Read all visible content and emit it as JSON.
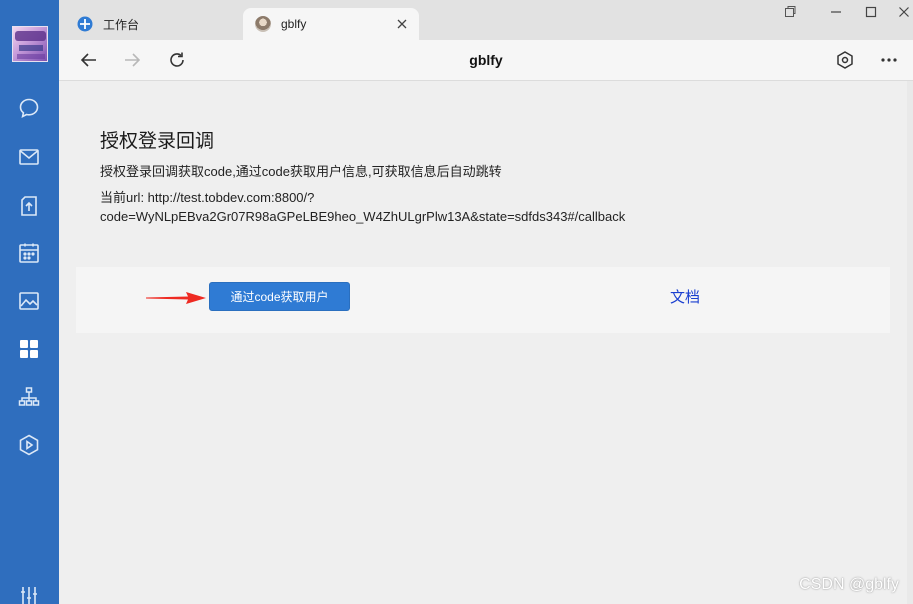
{
  "tabs": [
    {
      "label": "工作台"
    },
    {
      "label": "gblfy"
    }
  ],
  "toolbar": {
    "title": "gblfy"
  },
  "content": {
    "heading": "授权登录回调",
    "description": "授权登录回调获取code,通过code获取用户信息,可获取信息后自动跳转",
    "url_line1": "当前url: http://test.tobdev.com:8800/?",
    "url_line2": "code=WyNLpEBva2Gr07R98aGPeLBE9heo_W4ZhULgrPlw13A&state=sdfds343#/callback",
    "action_button": "通过code获取用户",
    "doc_link": "文档"
  },
  "watermark": "CSDN @gblfy",
  "colors": {
    "sidebar": "#2f6ebe",
    "button": "#2f7bd4",
    "link": "#1a3fd0",
    "arrow": "#ee2a22"
  },
  "icons": [
    "chat-icon",
    "mail-icon",
    "upload-icon",
    "calendar-icon",
    "image-icon",
    "apps-icon",
    "org-chart-icon",
    "video-icon",
    "settings-sliders-icon"
  ]
}
